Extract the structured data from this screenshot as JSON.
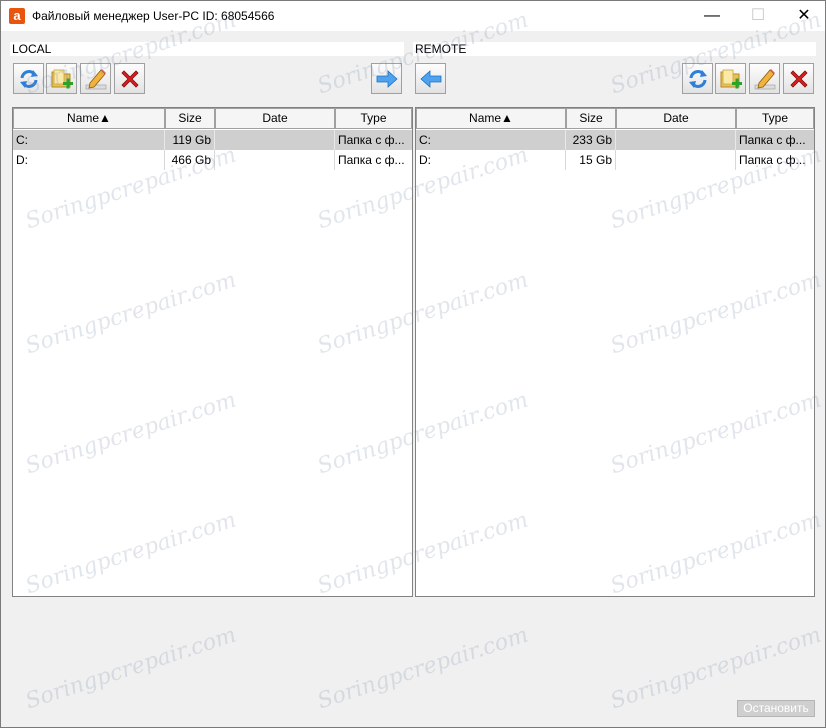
{
  "window": {
    "title": "Файловый менеджер User-PC ID: 68054566",
    "minimize_glyph": "—",
    "maximize_glyph": "☐",
    "close_glyph": "✕"
  },
  "local": {
    "header": "LOCAL",
    "columns": [
      "Name▲",
      "Size",
      "Date",
      "Type"
    ],
    "rows": [
      {
        "name": "C:",
        "size": "119 Gb",
        "date": "",
        "type": "Папка с ф..."
      },
      {
        "name": "D:",
        "size": "466 Gb",
        "date": "",
        "type": "Папка с ф..."
      }
    ],
    "toolbar": [
      "refresh-icon",
      "new-folder-icon",
      "rename-icon",
      "delete-icon"
    ],
    "transfer_icon": "arrow-right-icon"
  },
  "remote": {
    "header": "REMOTE",
    "columns": [
      "Name▲",
      "Size",
      "Date",
      "Type"
    ],
    "rows": [
      {
        "name": "C:",
        "size": "233 Gb",
        "date": "",
        "type": "Папка с ф..."
      },
      {
        "name": "D:",
        "size": "15 Gb",
        "date": "",
        "type": "Папка с ф..."
      }
    ],
    "toolbar": [
      "refresh-icon",
      "new-folder-icon",
      "rename-icon",
      "delete-icon"
    ],
    "transfer_icon": "arrow-left-icon"
  },
  "stop_button": "Остановить",
  "watermark": "Soringpcrepair.com",
  "colors": {
    "selected_row": "#cfcfcf",
    "app_icon": "#e8550c",
    "arrow": "#3a8ee6",
    "delete": "#d62020"
  }
}
